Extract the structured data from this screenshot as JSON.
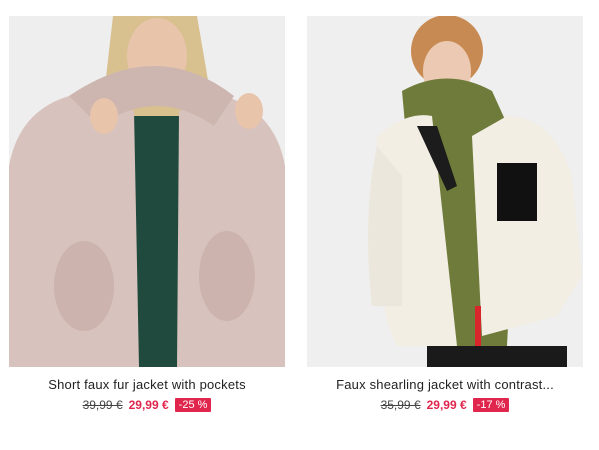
{
  "products": [
    {
      "title": "Short faux fur jacket with pockets",
      "old_price": "39,99 €",
      "new_price": "29,99 €",
      "discount": "-25 %"
    },
    {
      "title": "Faux shearling jacket with contrast...",
      "old_price": "35,99 €",
      "new_price": "29,99 €",
      "discount": "-17 %"
    }
  ],
  "colors": {
    "sale": "#e0264d",
    "background": "#ffffff",
    "photo_background": "#ececec"
  }
}
